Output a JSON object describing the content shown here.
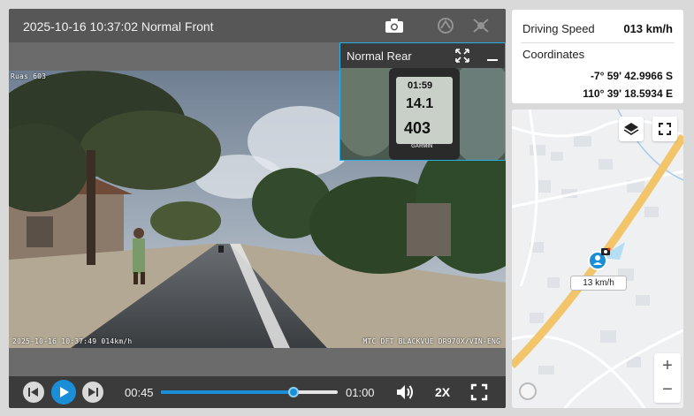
{
  "video": {
    "title": "2025-10-16 10:37:02 Normal Front",
    "icons": {
      "camera": "camera-icon",
      "ai": "ai-icon",
      "fx": "effects-icon"
    },
    "osd_corner": "Ruas 603",
    "osd_bottom_left": "2025-10-16 10:37:49 014km/h",
    "osd_bottom_right": "MTC DFT BLACKVUE DR970X/VIN-ENG"
  },
  "rear": {
    "title": "Normal Rear",
    "gps_time": "01:59",
    "gps_speed": "14.1",
    "gps_distance": "403",
    "gps_brand": "GARMIN"
  },
  "playback": {
    "current_time": "00:45",
    "total_time": "01:00",
    "progress": 0.75,
    "speed_label": "2X"
  },
  "info": {
    "speed_label": "Driving Speed",
    "speed_value": "013 km/h",
    "coords_label": "Coordinates",
    "latitude": "-7° 59' 42.9966 S",
    "longitude": "110° 39' 18.5934 E"
  },
  "map": {
    "vehicle_speed_tag": "13 km/h",
    "zoom_in": "+",
    "zoom_out": "−",
    "accent": "#1a8fd8",
    "road_color": "#f3c56b"
  }
}
